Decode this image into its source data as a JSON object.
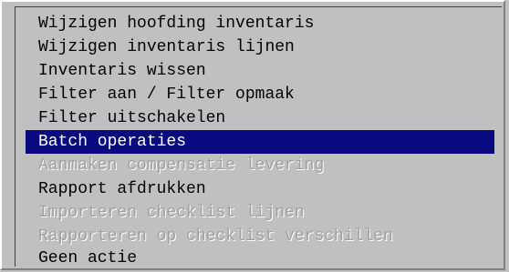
{
  "menu": {
    "items": [
      {
        "label": "Wijzigen hoofding inventaris",
        "state": "enabled"
      },
      {
        "label": "Wijzigen inventaris lijnen",
        "state": "enabled"
      },
      {
        "label": "Inventaris wissen",
        "state": "enabled"
      },
      {
        "label": "Filter aan / Filter opmaak",
        "state": "enabled"
      },
      {
        "label": "Filter uitschakelen",
        "state": "enabled"
      },
      {
        "label": "Batch operaties",
        "state": "selected"
      },
      {
        "label": "Aanmaken compensatie levering",
        "state": "disabled"
      },
      {
        "label": "Rapport afdrukken",
        "state": "enabled"
      },
      {
        "label": "Importeren checklist lijnen",
        "state": "disabled"
      },
      {
        "label": "Rapporteren op checklist verschillen",
        "state": "disabled"
      },
      {
        "label": "Geen actie",
        "state": "enabled"
      }
    ],
    "colors": {
      "background": "#c0c0c0",
      "selected_background": "#0a0a80",
      "selected_text": "#ffffff",
      "disabled_text": "#a0a0a0"
    }
  }
}
